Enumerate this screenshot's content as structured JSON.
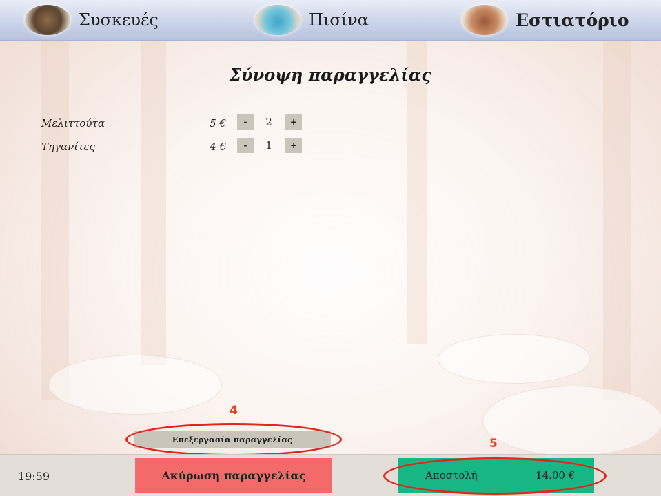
{
  "nav": {
    "tabs": [
      {
        "label": "Συσκευές",
        "icon": "appliances-thumbnail",
        "active": false
      },
      {
        "label": "Πισίνα",
        "icon": "pool-thumbnail",
        "active": false
      },
      {
        "label": "Εστιατόριο",
        "icon": "restaurant-thumbnail",
        "active": true
      }
    ]
  },
  "title": "Σύνοψη παραγγελίας",
  "order": {
    "items": [
      {
        "name": "Μελιττούτα",
        "price": "5 €",
        "quantity": "2",
        "minus": "-",
        "plus": "+"
      },
      {
        "name": "Τηγανίτες",
        "price": "4 €",
        "quantity": "1",
        "minus": "-",
        "plus": "+"
      }
    ]
  },
  "edit_button": "Επεξεργασία παραγγελίας",
  "annotations": {
    "edit": "4",
    "send": "5",
    "color": "#e3261a"
  },
  "footer": {
    "time": "19:59",
    "cancel_label": "Ακύρωση παραγγελίας",
    "send_label": "Αποστολή",
    "total": "14.00 €"
  },
  "colors": {
    "cancel": "#f46a6a",
    "send": "#18b585",
    "qty_button": "#c9c5bb"
  }
}
